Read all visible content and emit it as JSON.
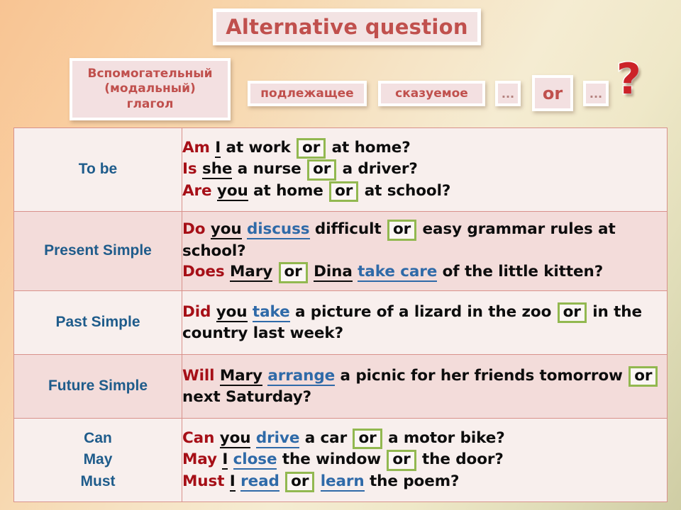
{
  "slide": {
    "title": "Alternative question",
    "question_mark": "?"
  },
  "structure": {
    "aux_box": "Вспомогательный (модальный) глагол",
    "aux_box_lines": [
      "Вспомогательный",
      "(модальный)",
      "глагол"
    ],
    "subject_box": "подлежащее",
    "predicate_box": "сказуемое",
    "dots_left": "...",
    "or_box": "or",
    "dots_right": "..."
  },
  "colors": {
    "title_red": "#c0504d",
    "tense_blue": "#1f5c8b",
    "aux_dark_red": "#a60f17",
    "verb_blue": "#2f6aa8",
    "or_border_green": "#92b850",
    "row_light": "#f8efed",
    "row_dark": "#f3dcda",
    "table_border": "#d8918b"
  },
  "table": {
    "rows": [
      {
        "tense": "To be",
        "tense_lines": [
          "To be"
        ],
        "examples": [
          {
            "aux": "Am",
            "subject": "I",
            "verb": "",
            "mid": "at work",
            "or": "or",
            "tail": "at home?"
          },
          {
            "aux": "Is",
            "subject": "she",
            "verb": "",
            "mid": "a nurse",
            "or": "or",
            "tail": "a driver?"
          },
          {
            "aux": "Are",
            "subject": "you",
            "verb": "",
            "mid": "at home",
            "or": "or",
            "tail": "at school?"
          }
        ]
      },
      {
        "tense": "Present Simple",
        "tense_lines": [
          "Present Simple"
        ],
        "examples": [
          {
            "aux": "Do",
            "subject": "you",
            "verb": "discuss",
            "mid": "difficult",
            "or": "or",
            "tail": "easy grammar rules at school?"
          },
          {
            "aux": "Does",
            "subject": "Mary",
            "or": "or",
            "subject2": "Dina",
            "verb": "take care",
            "tail": "of the little kitten?"
          }
        ]
      },
      {
        "tense": "Past Simple",
        "tense_lines": [
          "Past Simple"
        ],
        "examples": [
          {
            "aux": "Did",
            "subject": "you",
            "verb": "take",
            "mid": "a picture of a lizard in the zoo",
            "or": "or",
            "tail": "in the country last week?"
          }
        ]
      },
      {
        "tense": "Future Simple",
        "tense_lines": [
          "Future Simple"
        ],
        "examples": [
          {
            "aux": "Will",
            "subject": "Mary",
            "verb": "arrange",
            "mid": "a picnic for her friends tomorrow",
            "or": "or",
            "tail": "next Saturday?"
          }
        ]
      },
      {
        "tense": "Can May Must",
        "tense_lines": [
          "Can",
          "May",
          "Must"
        ],
        "examples": [
          {
            "aux": "Can",
            "subject": "you",
            "verb": "drive",
            "mid": "a car",
            "or": "or",
            "tail": "a motor bike?"
          },
          {
            "aux": "May",
            "subject": "I",
            "verb": "close",
            "mid": "the window",
            "or": "or",
            "tail": "the door?"
          },
          {
            "aux": "Must",
            "subject": "I",
            "verb": "read",
            "or": "or",
            "verb2": "learn",
            "tail": "the poem?"
          }
        ]
      }
    ]
  }
}
